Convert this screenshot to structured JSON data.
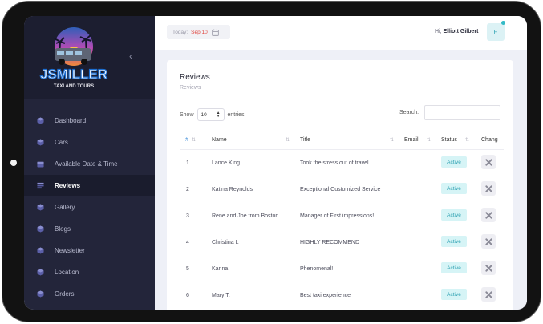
{
  "brand": {
    "logo_text": "JSMILLER",
    "logo_tagline": "TAXI AND TOURS"
  },
  "sidebar": {
    "items": [
      {
        "label": "Dashboard",
        "icon": "cube-icon",
        "active": false
      },
      {
        "label": "Cars",
        "icon": "cube-icon",
        "active": false
      },
      {
        "label": "Available Date & Time",
        "icon": "calendar-icon",
        "active": false
      },
      {
        "label": "Reviews",
        "icon": "list-icon",
        "active": true
      },
      {
        "label": "Gallery",
        "icon": "cube-icon",
        "active": false
      },
      {
        "label": "Blogs",
        "icon": "cube-icon",
        "active": false
      },
      {
        "label": "Newsletter",
        "icon": "cube-icon",
        "active": false
      },
      {
        "label": "Location",
        "icon": "cube-icon",
        "active": false
      },
      {
        "label": "Orders",
        "icon": "cube-icon",
        "active": false
      }
    ]
  },
  "header": {
    "today_label": "Today:",
    "today_date": "Sep 10",
    "greeting": "Hi,",
    "user_name": "Elliott Gilbert",
    "avatar_initial": "E"
  },
  "page": {
    "title": "Reviews",
    "breadcrumb": "Reviews"
  },
  "table_controls": {
    "show_label": "Show",
    "entries_value": "10",
    "entries_label": "entries",
    "search_label": "Search:"
  },
  "table": {
    "columns": [
      "#",
      "Name",
      "Title",
      "Email",
      "Status",
      "Chang"
    ],
    "rows": [
      {
        "num": "1",
        "name": "Lance King",
        "title": "Took the stress out of travel",
        "email": "",
        "status": "Active"
      },
      {
        "num": "2",
        "name": "Katina Reynolds",
        "title": "Exceptional Customized Service",
        "email": "",
        "status": "Active"
      },
      {
        "num": "3",
        "name": "Rene and Joe from Boston",
        "title": "Manager of First impressions!",
        "email": "",
        "status": "Active"
      },
      {
        "num": "4",
        "name": "Christina L",
        "title": "HIGHLY RECOMMEND",
        "email": "",
        "status": "Active"
      },
      {
        "num": "5",
        "name": "Karina",
        "title": "Phenomenal!",
        "email": "",
        "status": "Active"
      },
      {
        "num": "6",
        "name": "Mary T.",
        "title": "Best taxi experience",
        "email": "",
        "status": "Active"
      }
    ]
  },
  "colors": {
    "sidebar_bg": "#23253a",
    "accent_teal": "#2fa2b2",
    "badge_bg": "#d6f4f6",
    "date_red": "#e0453f"
  }
}
